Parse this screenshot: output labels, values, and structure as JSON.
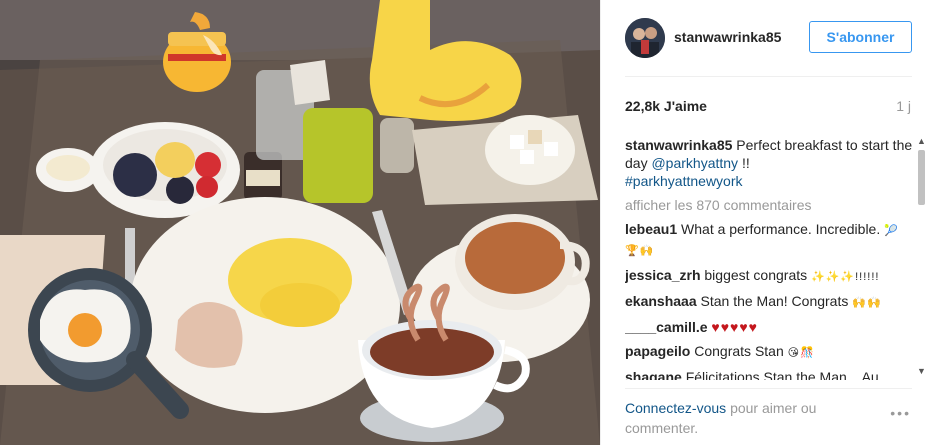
{
  "header": {
    "username": "stanwawrinka85",
    "follow_label": "S'abonner"
  },
  "stats": {
    "likes": "22,8k J'aime",
    "time": "1 j"
  },
  "caption": {
    "user": "stanwawrinka85",
    "text": "Perfect breakfast to start the day",
    "mention": "@parkhyattny",
    "suffix": "!!",
    "hashtag": "#parkhyattnewyork"
  },
  "load_more": "afficher les 870 commentaires",
  "comments": [
    {
      "user": "lebeau1",
      "text": "What a performance. Incredible.",
      "emoji": "🎾🏆🙌"
    },
    {
      "user": "jessica_zrh",
      "text": "biggest congrats",
      "emoji": "✨✨✨!!!!!!"
    },
    {
      "user": "ekanshaaa",
      "text": "Stan the Man! Congrats",
      "emoji": "🙌🙌"
    },
    {
      "user": "____camill.e",
      "text": "",
      "emoji": "♥♥♥♥♥"
    },
    {
      "user": "papageilo",
      "text": "Congrats Stan",
      "emoji": "😘🎊"
    },
    {
      "user": "shagane",
      "text": "Félicitations Stan the Man... Au",
      "emoji": ""
    }
  ],
  "footer": {
    "login_link": "Connectez-vous",
    "login_text": "pour aimer ou commenter.",
    "more_icon": "more-options-icon"
  },
  "colors": {
    "accent": "#3897f0",
    "link": "#125688",
    "muted": "#999999"
  }
}
